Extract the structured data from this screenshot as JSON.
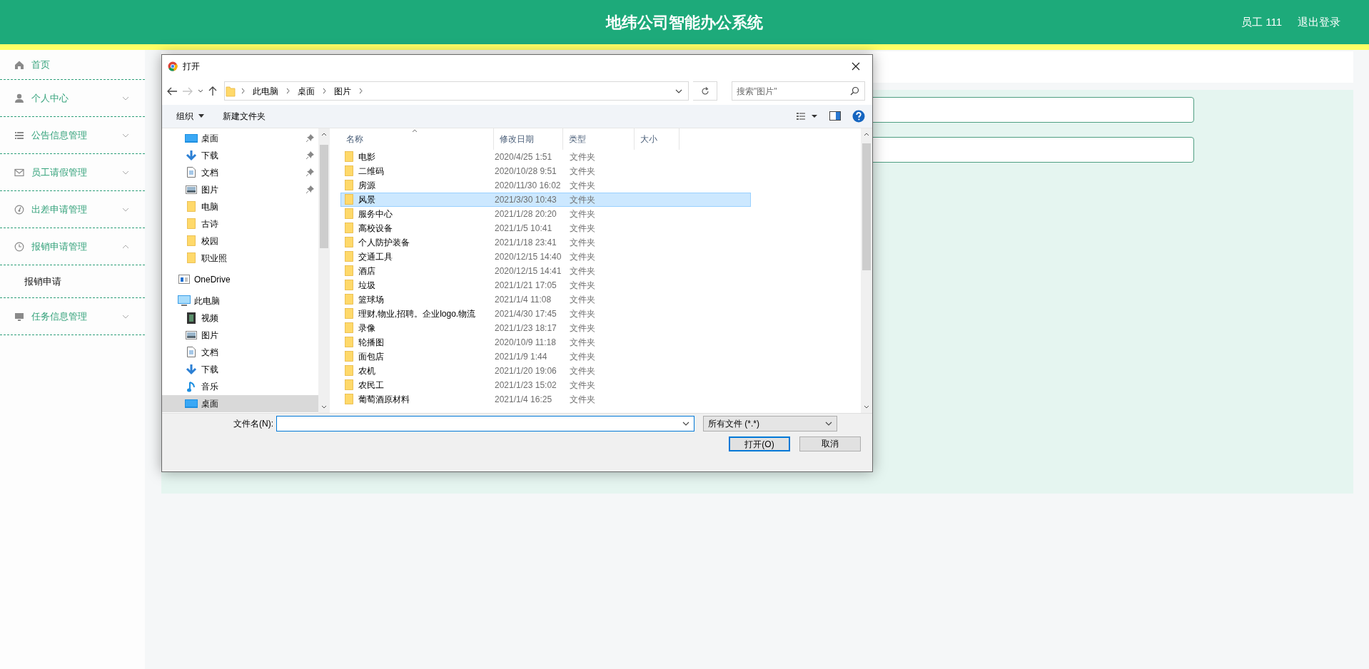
{
  "header": {
    "title": "地纬公司智能办公系统",
    "user": "员工 111",
    "logout": "退出登录"
  },
  "sidebar": {
    "items": [
      {
        "label": "首页",
        "kind": "link"
      },
      {
        "label": "个人中心",
        "kind": "menu",
        "expanded": false
      },
      {
        "label": "公告信息管理",
        "kind": "menu",
        "expanded": false
      },
      {
        "label": "员工请假管理",
        "kind": "menu",
        "expanded": false
      },
      {
        "label": "出差申请管理",
        "kind": "menu",
        "expanded": false
      },
      {
        "label": "报销申请管理",
        "kind": "menu",
        "expanded": true,
        "children": [
          {
            "label": "报销申请"
          }
        ]
      },
      {
        "label": "任务信息管理",
        "kind": "menu",
        "expanded": false
      }
    ]
  },
  "dialog": {
    "title": "打开",
    "address": {
      "crumbs": [
        "此电脑",
        "桌面",
        "图片"
      ]
    },
    "search": {
      "placeholder": "搜索\"图片\""
    },
    "toolbar": {
      "organize": "组织",
      "new_folder": "新建文件夹"
    },
    "nav": {
      "quick_access": [
        {
          "label": "桌面",
          "kind": "desktop",
          "pinned": true,
          "selected": false
        },
        {
          "label": "下载",
          "kind": "download",
          "pinned": true,
          "selected": false
        },
        {
          "label": "文档",
          "kind": "document",
          "pinned": true,
          "selected": false
        },
        {
          "label": "图片",
          "kind": "picture",
          "pinned": true,
          "selected": false
        },
        {
          "label": "电脑",
          "kind": "folder",
          "pinned": false,
          "selected": false
        },
        {
          "label": "古诗",
          "kind": "folder",
          "pinned": false,
          "selected": false
        },
        {
          "label": "校园",
          "kind": "folder",
          "pinned": false,
          "selected": false
        },
        {
          "label": "职业照",
          "kind": "folder",
          "pinned": false,
          "selected": false
        }
      ],
      "roots": [
        {
          "label": "OneDrive",
          "kind": "cloud",
          "selected": false
        },
        {
          "label": "此电脑",
          "kind": "computer",
          "selected": false,
          "children": [
            {
              "label": "视频",
              "kind": "video",
              "pinned": false,
              "selected": false
            },
            {
              "label": "图片",
              "kind": "picture",
              "pinned": false,
              "selected": false
            },
            {
              "label": "文档",
              "kind": "document",
              "pinned": false,
              "selected": false
            },
            {
              "label": "下载",
              "kind": "download",
              "pinned": false,
              "selected": false
            },
            {
              "label": "音乐",
              "kind": "music",
              "pinned": false,
              "selected": false
            },
            {
              "label": "桌面",
              "kind": "desktop",
              "pinned": false,
              "selected": true
            }
          ]
        }
      ]
    },
    "columns": [
      "名称",
      "修改日期",
      "类型",
      "大小"
    ],
    "rows": [
      {
        "name": "电影",
        "date": "2020/4/25 1:51",
        "type": "文件夹",
        "selected": false
      },
      {
        "name": "二维码",
        "date": "2020/10/28 9:51",
        "type": "文件夹",
        "selected": false
      },
      {
        "name": "房源",
        "date": "2020/11/30 16:02",
        "type": "文件夹",
        "selected": false
      },
      {
        "name": "风景",
        "date": "2021/3/30 10:43",
        "type": "文件夹",
        "selected": true
      },
      {
        "name": "服务中心",
        "date": "2021/1/28 20:20",
        "type": "文件夹",
        "selected": false
      },
      {
        "name": "高校设备",
        "date": "2021/1/5 10:41",
        "type": "文件夹",
        "selected": false
      },
      {
        "name": "个人防护装备",
        "date": "2021/1/18 23:41",
        "type": "文件夹",
        "selected": false
      },
      {
        "name": "交通工具",
        "date": "2020/12/15 14:40",
        "type": "文件夹",
        "selected": false
      },
      {
        "name": "酒店",
        "date": "2020/12/15 14:41",
        "type": "文件夹",
        "selected": false
      },
      {
        "name": "垃圾",
        "date": "2021/1/21 17:05",
        "type": "文件夹",
        "selected": false
      },
      {
        "name": "篮球场",
        "date": "2021/1/4 11:08",
        "type": "文件夹",
        "selected": false
      },
      {
        "name": "理财,物业,招聘。企业logo.物流",
        "date": "2021/4/30 17:45",
        "type": "文件夹",
        "selected": false
      },
      {
        "name": "录像",
        "date": "2021/1/23 18:17",
        "type": "文件夹",
        "selected": false
      },
      {
        "name": "轮播图",
        "date": "2020/10/9 11:18",
        "type": "文件夹",
        "selected": false
      },
      {
        "name": "面包店",
        "date": "2021/1/9 1:44",
        "type": "文件夹",
        "selected": false
      },
      {
        "name": "农机",
        "date": "2021/1/20 19:06",
        "type": "文件夹",
        "selected": false
      },
      {
        "name": "农民工",
        "date": "2021/1/23 15:02",
        "type": "文件夹",
        "selected": false
      },
      {
        "name": "葡萄酒原材料",
        "date": "2021/1/4 16:25",
        "type": "文件夹",
        "selected": false
      }
    ],
    "filename_label": "文件名(N):",
    "filter": "所有文件 (*.*)",
    "buttons": [
      {
        "label": "打开(O)",
        "kind": "default"
      },
      {
        "label": "取消",
        "kind": "normal"
      }
    ]
  }
}
